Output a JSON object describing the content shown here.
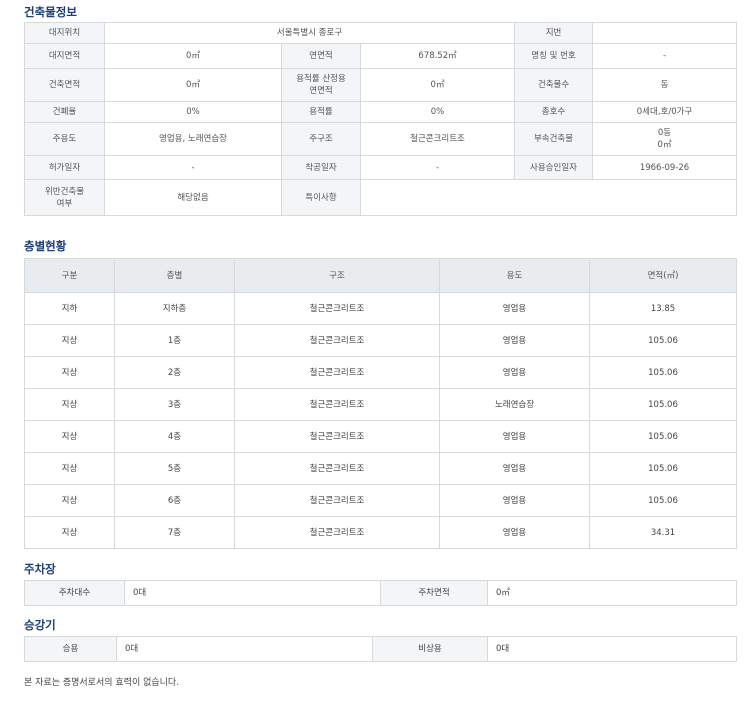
{
  "building": {
    "title": "건축물정보",
    "rows": [
      [
        {
          "l": "대지위치"
        },
        {
          "v": "서울특별시 종로구",
          "span": 3
        },
        {
          "l": "지번"
        },
        {
          "v": ""
        }
      ],
      [
        {
          "l": "대지면적"
        },
        {
          "v": "0㎡"
        },
        {
          "l": "연면적"
        },
        {
          "v": "678.52㎡"
        },
        {
          "l": "명칭 및 번호"
        },
        {
          "v": "-"
        }
      ],
      [
        {
          "l": "건축면적"
        },
        {
          "v": "0㎡"
        },
        {
          "l": "용적률 산정용\n연면적"
        },
        {
          "v": "0㎡"
        },
        {
          "l": "건축물수"
        },
        {
          "v": "동"
        }
      ],
      [
        {
          "l": "건폐율"
        },
        {
          "v": "0%"
        },
        {
          "l": "용적률"
        },
        {
          "v": "0%"
        },
        {
          "l": "총호수"
        },
        {
          "v": "0세대,호/0가구"
        }
      ],
      [
        {
          "l": "주용도"
        },
        {
          "v": "영업용, 노래연습장"
        },
        {
          "l": "주구조"
        },
        {
          "v": "철근콘크리트조"
        },
        {
          "l": "부속건축물"
        },
        {
          "v": "0동\n0㎡"
        }
      ],
      [
        {
          "l": "허가일자"
        },
        {
          "v": "-"
        },
        {
          "l": "착공일자"
        },
        {
          "v": "-"
        },
        {
          "l": "사용승인일자"
        },
        {
          "v": "1966-09-26"
        }
      ],
      [
        {
          "l": "위반건축물\n여부"
        },
        {
          "v": "해당없음"
        },
        {
          "l": "특이사항"
        },
        {
          "v": "",
          "span": 3
        }
      ]
    ]
  },
  "floors": {
    "title": "층별현황",
    "headers": [
      "구분",
      "층별",
      "구조",
      "용도",
      "면적(㎡)"
    ],
    "rows": [
      [
        "지하",
        "지하층",
        "철근콘크리트조",
        "영업용",
        "13.85"
      ],
      [
        "지상",
        "1층",
        "철근콘크리트조",
        "영업용",
        "105.06"
      ],
      [
        "지상",
        "2층",
        "철근콘크리트조",
        "영업용",
        "105.06"
      ],
      [
        "지상",
        "3층",
        "철근콘크리트조",
        "노래연습장",
        "105.06"
      ],
      [
        "지상",
        "4층",
        "철근콘크리트조",
        "영업용",
        "105.06"
      ],
      [
        "지상",
        "5층",
        "철근콘크리트조",
        "영업용",
        "105.06"
      ],
      [
        "지상",
        "6층",
        "철근콘크리트조",
        "영업용",
        "105.06"
      ],
      [
        "지상",
        "7층",
        "철근콘크리트조",
        "영업용",
        "34.31"
      ]
    ]
  },
  "parking": {
    "title": "주차장",
    "count_label": "주차대수",
    "count_value": "0대",
    "area_label": "주차면적",
    "area_value": "0㎡"
  },
  "elevator": {
    "title": "승강기",
    "passenger_label": "승용",
    "passenger_value": "0대",
    "emergency_label": "비상용",
    "emergency_value": "0대"
  },
  "notice": "본 자료는 증명서로서의 효력이 없습니다."
}
